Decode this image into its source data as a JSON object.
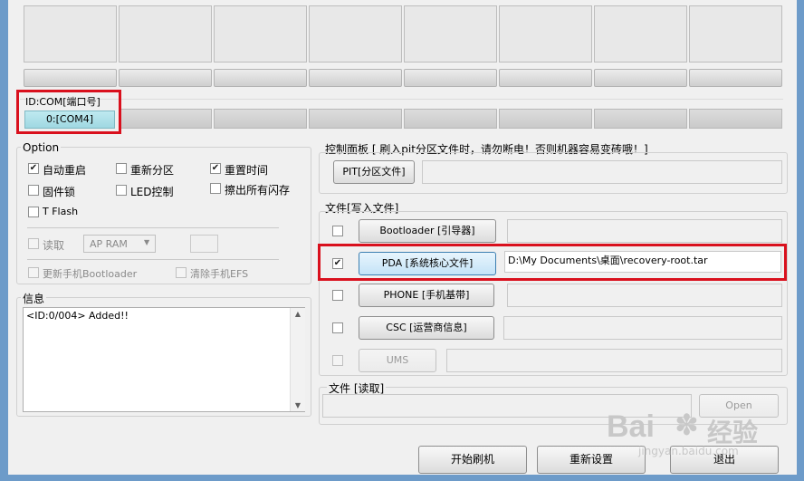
{
  "ports": {
    "count": 8,
    "com_label": "ID:COM[端口号]",
    "com_value": "0:[COM4]"
  },
  "option": {
    "title": "Option",
    "auto_reboot": {
      "label": "自动重启",
      "checked": true
    },
    "repartition": {
      "label": "重新分区",
      "checked": false
    },
    "reset_time": {
      "label": "重置时间",
      "checked": true
    },
    "firmware_lock": {
      "label": "固件锁",
      "checked": false
    },
    "led_control": {
      "label": "LED控制",
      "checked": false
    },
    "erase_all_flash": {
      "label": "擦出所有闪存",
      "checked": false
    },
    "t_flash": {
      "label": "T Flash",
      "checked": false
    },
    "read": {
      "label": "读取",
      "checked": false
    },
    "read_select": "AP RAM",
    "update_bootloader": {
      "label": "更新手机Bootloader",
      "checked": false
    },
    "clear_efs": {
      "label": "清除手机EFS",
      "checked": false
    }
  },
  "info": {
    "title": "信息",
    "log": "<ID:0/004> Added!!"
  },
  "control_panel": {
    "title": "控制面板 [ 刷入pit分区文件时，请勿断电！否则机器容易变砖哦！]",
    "pit_button": "PIT[分区文件]"
  },
  "files": {
    "title": "文件[写入文件]",
    "bootloader": {
      "label": "Bootloader [引导器]",
      "checked": false,
      "path": ""
    },
    "pda": {
      "label": "PDA [系统核心文件]",
      "checked": true,
      "path": "D:\\My Documents\\桌面\\recovery-root.tar"
    },
    "phone": {
      "label": "PHONE [手机基带]",
      "checked": false,
      "path": ""
    },
    "csc": {
      "label": "CSC [运营商信息]",
      "checked": false,
      "path": ""
    },
    "ums": {
      "label": "UMS",
      "checked": false,
      "path": ""
    }
  },
  "read_file": {
    "title": "文件 [读取]",
    "open_button": "Open"
  },
  "actions": {
    "start": "开始刷机",
    "reset": "重新设置",
    "exit": "退出"
  },
  "watermark": {
    "brand": "Bai",
    "brand2": "经验",
    "url": "jingyan.baidu.com"
  },
  "icons": {
    "check": "check-icon",
    "dropdown": "chevron-down-icon",
    "paw": "paw-icon"
  }
}
